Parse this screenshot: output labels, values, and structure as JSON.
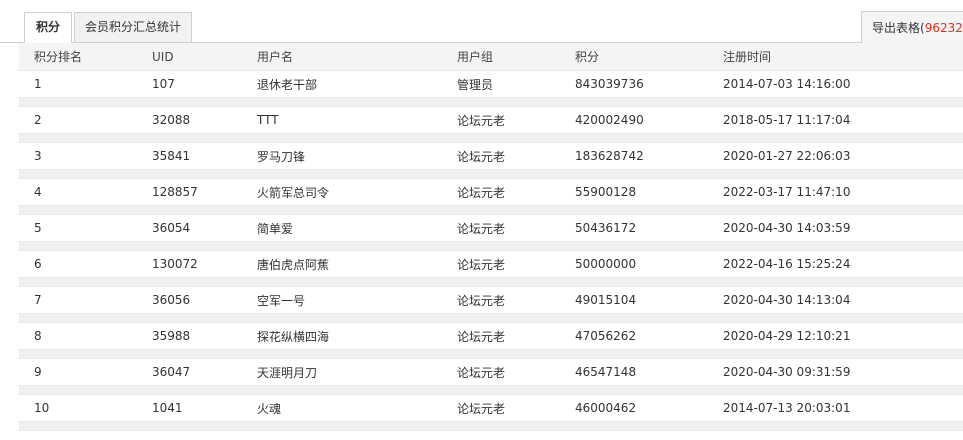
{
  "tabs": {
    "active_label": "积分",
    "summary_label": "会员积分汇总统计"
  },
  "export": {
    "label": "导出表格(",
    "count": "96232",
    "suffix": ")"
  },
  "table": {
    "headers": [
      "积分排名",
      "UID",
      "用户名",
      "用户组",
      "积分",
      "注册时间"
    ],
    "rows": [
      {
        "rank": "1",
        "uid": "107",
        "username": "退休老干部",
        "group": "管理员",
        "points": "843039736",
        "registered": "2014-07-03 14:16:00"
      },
      {
        "rank": "2",
        "uid": "32088",
        "username": "TTT",
        "group": "论坛元老",
        "points": "420002490",
        "registered": "2018-05-17 11:17:04"
      },
      {
        "rank": "3",
        "uid": "35841",
        "username": "罗马刀锋",
        "group": "论坛元老",
        "points": "183628742",
        "registered": "2020-01-27 22:06:03"
      },
      {
        "rank": "4",
        "uid": "128857",
        "username": "火箭军总司令",
        "group": "论坛元老",
        "points": "55900128",
        "registered": "2022-03-17 11:47:10"
      },
      {
        "rank": "5",
        "uid": "36054",
        "username": "简单爱",
        "group": "论坛元老",
        "points": "50436172",
        "registered": "2020-04-30 14:03:59"
      },
      {
        "rank": "6",
        "uid": "130072",
        "username": "唐伯虎点阿蕉",
        "group": "论坛元老",
        "points": "50000000",
        "registered": "2022-04-16 15:25:24"
      },
      {
        "rank": "7",
        "uid": "36056",
        "username": "空军一号",
        "group": "论坛元老",
        "points": "49015104",
        "registered": "2020-04-30 14:13:04"
      },
      {
        "rank": "8",
        "uid": "35988",
        "username": "探花纵横四海",
        "group": "论坛元老",
        "points": "47056262",
        "registered": "2020-04-29 12:10:21"
      },
      {
        "rank": "9",
        "uid": "36047",
        "username": "天涯明月刀",
        "group": "论坛元老",
        "points": "46547148",
        "registered": "2020-04-30 09:31:59"
      },
      {
        "rank": "10",
        "uid": "1041",
        "username": "火魂",
        "group": "论坛元老",
        "points": "46000462",
        "registered": "2014-07-13 20:03:01"
      }
    ]
  }
}
